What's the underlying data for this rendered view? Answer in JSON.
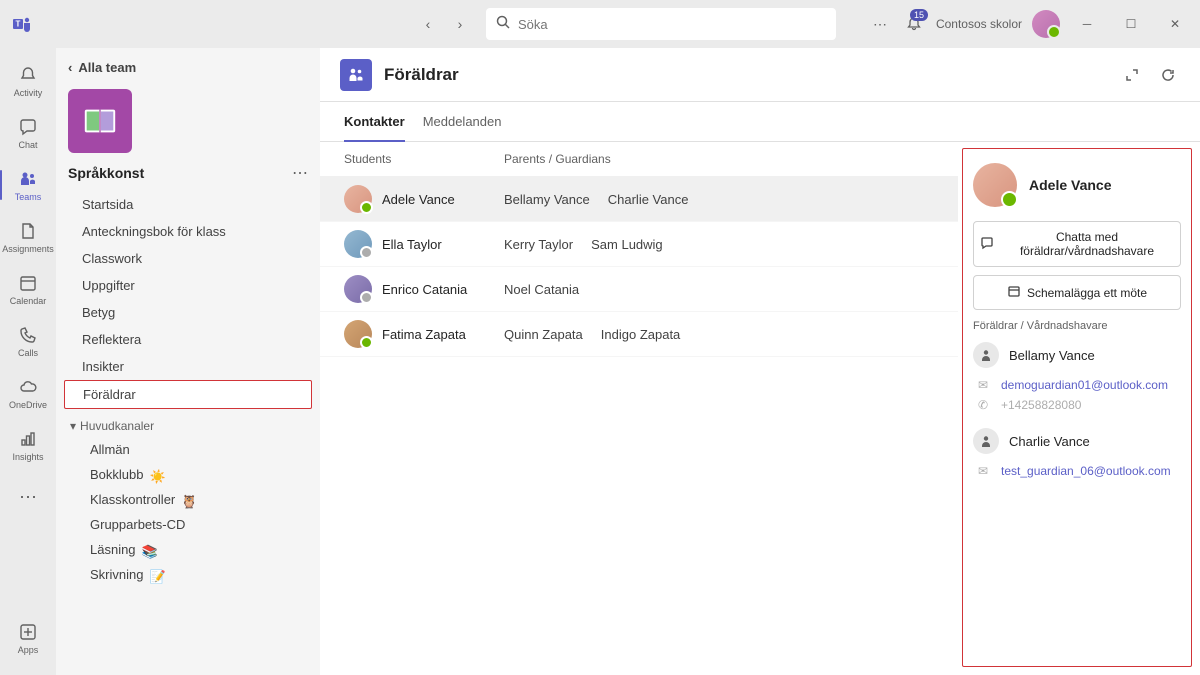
{
  "titlebar": {
    "search_placeholder": "Söka",
    "notif_count": "15",
    "org": "Contosos skolor"
  },
  "rail": {
    "activity": "Activity",
    "chat": "Chat",
    "teams": "Teams",
    "assignments": "Assignments",
    "calendar": "Calendar",
    "calls": "Calls",
    "onedrive": "OneDrive",
    "insights": "Insights",
    "apps": "Apps"
  },
  "teampanel": {
    "all_teams": "Alla team",
    "team_name": "Språkkonst",
    "nav": {
      "home": "Startsida",
      "notebook": "Anteckningsbok för klass",
      "classwork": "Classwork",
      "assignments": "Uppgifter",
      "grades": "Betyg",
      "reflect": "Reflektera",
      "insights": "Insikter",
      "parents": "Föräldrar"
    },
    "channels_label": "Huvudkanaler",
    "channels": {
      "general": "Allmän",
      "bookclub": "Bokklubb",
      "classcheck": "Klasskontroller",
      "groupwork": "Grupparbets-CD",
      "reading": "Läsning",
      "writing": "Skrivning"
    }
  },
  "content": {
    "title": "Föräldrar",
    "tabs": {
      "contacts": "Kontakter",
      "messages": "Meddelanden"
    },
    "columns": {
      "students": "Students",
      "guardians": "Parents / Guardians"
    },
    "rows": [
      {
        "student": "Adele Vance",
        "g1": "Bellamy Vance",
        "g2": "Charlie Vance"
      },
      {
        "student": "Ella Taylor",
        "g1": "Kerry Taylor",
        "g2": "Sam Ludwig"
      },
      {
        "student": "Enrico Catania",
        "g1": "Noel Catania",
        "g2": ""
      },
      {
        "student": "Fatima Zapata",
        "g1": "Quinn Zapata",
        "g2": "Indigo Zapata"
      }
    ]
  },
  "detail": {
    "name": "Adele Vance",
    "chat_btn": "Chatta med föräldrar/vårdnadshavare",
    "meet_btn": "Schemalägga ett möte",
    "section": "Föräldrar / Vårdnadshavare",
    "guardians": [
      {
        "name": "Bellamy Vance",
        "email": "demoguardian01@outlook.com",
        "phone": "+14258828080"
      },
      {
        "name": "Charlie Vance",
        "email": "test_guardian_06@outlook.com",
        "phone": ""
      }
    ]
  }
}
